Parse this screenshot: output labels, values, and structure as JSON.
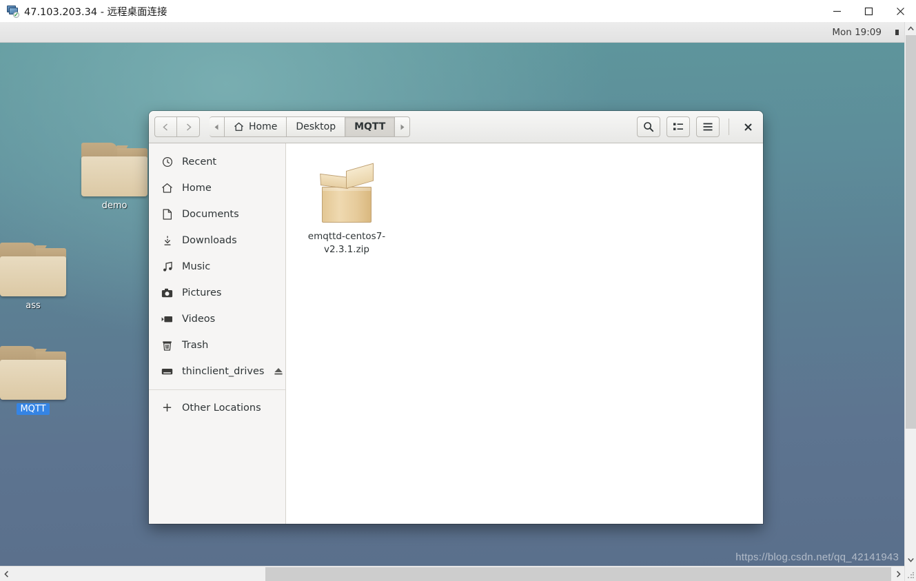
{
  "rdp": {
    "title": "47.103.203.34 - 远程桌面连接",
    "icon": "remote-desktop-icon",
    "window_controls": {
      "minimize": "minimize-icon",
      "maximize": "maximize-icon",
      "close": "close-icon"
    }
  },
  "gnome": {
    "clock": "Mon 19:09"
  },
  "desktop": {
    "icons": [
      {
        "label": "demo",
        "selected": false,
        "type": "folder"
      },
      {
        "label": "ass",
        "selected": false,
        "type": "folder"
      },
      {
        "label": "MQTT",
        "selected": true,
        "type": "folder"
      }
    ],
    "watermark": "https://blog.csdn.net/qq_42141943"
  },
  "file_manager": {
    "nav": {
      "back_icon": "chevron-left-icon",
      "forward_icon": "chevron-right-icon"
    },
    "breadcrumb": {
      "scroll_left_icon": "triangle-left-icon",
      "scroll_right_icon": "triangle-right-icon",
      "items": [
        {
          "label": "Home",
          "icon": "home-icon",
          "active": false
        },
        {
          "label": "Desktop",
          "icon": "",
          "active": false
        },
        {
          "label": "MQTT",
          "icon": "",
          "active": true
        }
      ]
    },
    "toolbar": {
      "search_icon": "search-icon",
      "view_toggle_icon": "list-view-icon",
      "menu_icon": "hamburger-menu-icon",
      "close_icon": "close-icon"
    },
    "sidebar": {
      "items": [
        {
          "label": "Recent",
          "icon": "clock-icon"
        },
        {
          "label": "Home",
          "icon": "home-icon"
        },
        {
          "label": "Documents",
          "icon": "document-icon"
        },
        {
          "label": "Downloads",
          "icon": "download-icon"
        },
        {
          "label": "Music",
          "icon": "music-note-icon"
        },
        {
          "label": "Pictures",
          "icon": "camera-icon"
        },
        {
          "label": "Videos",
          "icon": "video-icon"
        },
        {
          "label": "Trash",
          "icon": "trash-icon"
        },
        {
          "label": "thinclient_drives",
          "icon": "drive-icon",
          "eject": "eject-icon"
        }
      ],
      "other_locations": {
        "label": "Other Locations",
        "icon": "plus-icon"
      }
    },
    "files": [
      {
        "name": "emqttd-centos7-v2.3.1.zip",
        "type": "archive"
      }
    ]
  },
  "scrollbars": {
    "vertical": {
      "up_icon": "chevron-up-icon",
      "down_icon": "chevron-down-icon"
    },
    "horizontal": {
      "left_icon": "chevron-left-icon",
      "right_icon": "chevron-right-icon"
    }
  }
}
